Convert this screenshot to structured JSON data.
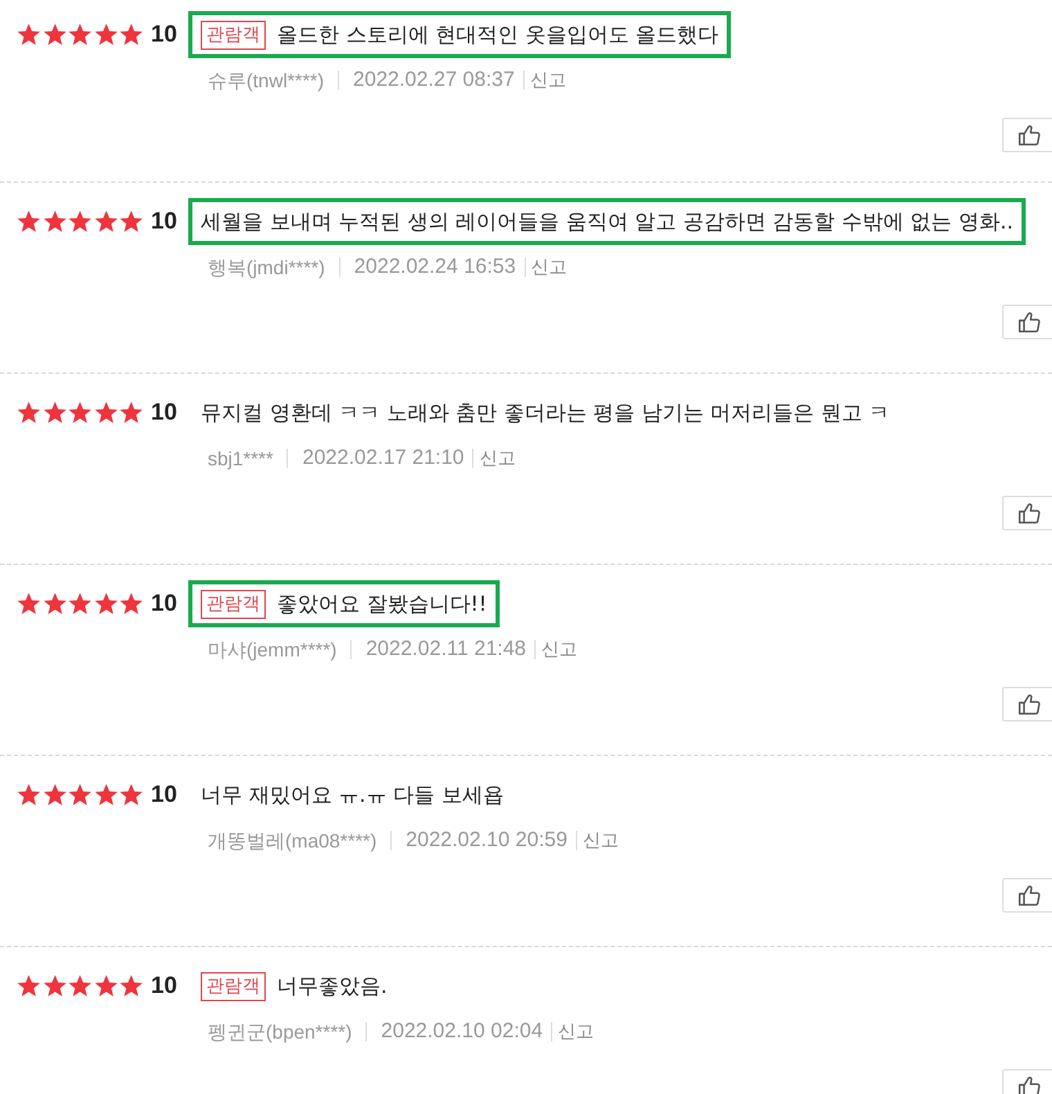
{
  "reviews": [
    {
      "stars": 5,
      "score": "10",
      "badge": "관람객",
      "text": "올드한 스토리에 현대적인 옷을입어도 올드했다",
      "user": "슈루(tnwl****)",
      "date": "2022.02.27 08:37",
      "report": "신고",
      "highlighted": true
    },
    {
      "stars": 5,
      "score": "10",
      "text": "세월을 보내며 누적된 생의 레이어들을 움직여 알고 공감하면 감동할 수밖에 없는 영화..",
      "user": "행복(jmdi****)",
      "date": "2022.02.24 16:53",
      "report": "신고",
      "highlighted": true
    },
    {
      "stars": 5,
      "score": "10",
      "text": "뮤지컬 영환데 ㅋㅋ 노래와 춤만 좋더라는 평을 남기는 머저리들은 뭔고 ㅋ",
      "user": "sbj1****",
      "date": "2022.02.17 21:10",
      "report": "신고",
      "highlighted": false
    },
    {
      "stars": 5,
      "score": "10",
      "badge": "관람객",
      "text": "좋았어요 잘봤습니다!!",
      "user": "마샤(jemm****)",
      "date": "2022.02.11 21:48",
      "report": "신고",
      "highlighted": true
    },
    {
      "stars": 5,
      "score": "10",
      "text": "너무 재밌어요 ㅠ.ㅠ 다들 보세욥",
      "user": "개똥벌레(ma08****)",
      "date": "2022.02.10 20:59",
      "report": "신고",
      "highlighted": false
    },
    {
      "stars": 5,
      "score": "10",
      "badge": "관람객",
      "text": "너무좋았음.",
      "user": "펭귄군(bpen****)",
      "date": "2022.02.10 02:04",
      "report": "신고",
      "highlighted": false
    }
  ]
}
